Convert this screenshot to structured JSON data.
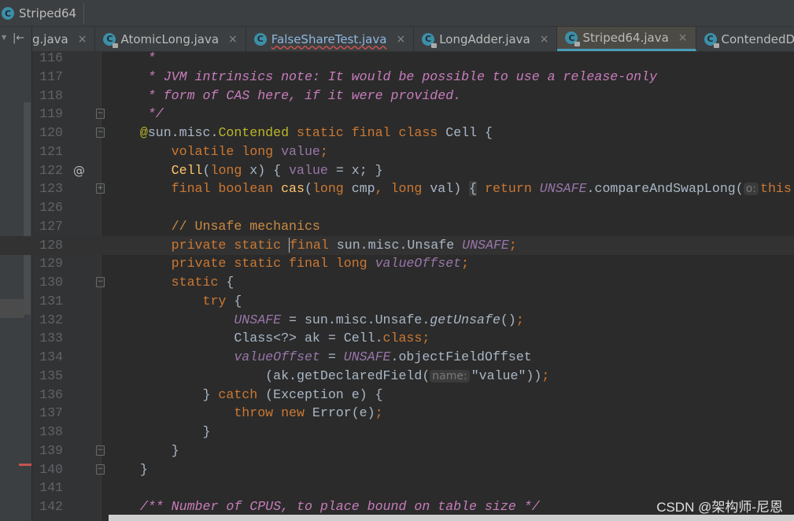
{
  "breadcrumb": {
    "label": "Striped64",
    "icon": "class-icon"
  },
  "tabs": [
    {
      "label": "g.java",
      "active": false
    },
    {
      "label": "AtomicLong.java",
      "active": false
    },
    {
      "label": "FalseShareTest.java",
      "active": false,
      "error": true
    },
    {
      "label": "LongAdder.java",
      "active": false
    },
    {
      "label": "Striped64.java",
      "active": true
    },
    {
      "label": "ContendedDemo.java",
      "active": false
    }
  ],
  "tab_close": "×",
  "colors": {
    "keyword": "#cc7832",
    "doc_comment": "#c77dbb",
    "field": "#9876aa",
    "annotation": "#bbb529",
    "method_decl": "#ffc66d",
    "text": "#a9b7c6",
    "active_tab_underline": "#4a9cb8"
  },
  "code": [
    {
      "n": "116",
      "fold": "",
      "toks": [
        [
          "     *",
          "doc"
        ]
      ]
    },
    {
      "n": "117",
      "fold": "",
      "toks": [
        [
          "     * JVM intrinsics note: It would be possible to use a release-only",
          "doc"
        ]
      ]
    },
    {
      "n": "118",
      "fold": "",
      "toks": [
        [
          "     * form of CAS here, if it were provided.",
          "doc"
        ]
      ]
    },
    {
      "n": "119",
      "fold": "-",
      "toks": [
        [
          "     */",
          "doc"
        ]
      ]
    },
    {
      "n": "120",
      "fold": "-",
      "toks": [
        [
          "    ",
          ""
        ],
        [
          "@",
          "ann"
        ],
        [
          "sun.misc.",
          ""
        ],
        [
          "Contended",
          "ann"
        ],
        [
          " static final class ",
          "kw"
        ],
        [
          "Cell {",
          ""
        ]
      ]
    },
    {
      "n": "121",
      "fold": "",
      "toks": [
        [
          "        ",
          ""
        ],
        [
          "volatile long ",
          "kw"
        ],
        [
          "value",
          "field"
        ],
        [
          ";",
          "kw"
        ]
      ]
    },
    {
      "n": "122",
      "fold": "",
      "at": "@",
      "toks": [
        [
          "        ",
          ""
        ],
        [
          "Cell",
          "decl"
        ],
        [
          "(",
          ""
        ],
        [
          "long ",
          "kw"
        ],
        [
          "x) { ",
          ""
        ],
        [
          "value",
          "field"
        ],
        [
          " = x; }",
          ""
        ]
      ]
    },
    {
      "n": "123",
      "fold": "+",
      "toks": [
        [
          "        ",
          ""
        ],
        [
          "final boolean ",
          "kw"
        ],
        [
          "cas",
          "decl"
        ],
        [
          "(",
          ""
        ],
        [
          "long ",
          "kw"
        ],
        [
          "cmp",
          ""
        ],
        [
          ", ",
          "kw"
        ],
        [
          "long ",
          "kw"
        ],
        [
          "val) ",
          ""
        ],
        [
          "{",
          "foldbox"
        ],
        [
          " ",
          ""
        ],
        [
          "return ",
          "kw"
        ],
        [
          "UNSAFE",
          "sfield"
        ],
        [
          ".compareAndSwapLong(",
          ""
        ],
        [
          "o:",
          "hint"
        ],
        [
          "this",
          "kw"
        ]
      ]
    },
    {
      "n": "126",
      "fold": "",
      "toks": []
    },
    {
      "n": "127",
      "fold": "",
      "toks": [
        [
          "        ",
          ""
        ],
        [
          "// Unsafe mechanics",
          "cmt"
        ]
      ]
    },
    {
      "n": "128",
      "fold": "",
      "cur": true,
      "toks": [
        [
          "        ",
          ""
        ],
        [
          "private static ",
          "kw"
        ],
        [
          "final ",
          "kw caret"
        ],
        [
          "sun.misc.Unsafe ",
          ""
        ],
        [
          "UNSAFE",
          "sfield"
        ],
        [
          ";",
          "kw"
        ]
      ]
    },
    {
      "n": "129",
      "fold": "",
      "toks": [
        [
          "        ",
          ""
        ],
        [
          "private static final long ",
          "kw"
        ],
        [
          "valueOffset",
          "sfield"
        ],
        [
          ";",
          "kw"
        ]
      ]
    },
    {
      "n": "130",
      "fold": "-",
      "toks": [
        [
          "        ",
          ""
        ],
        [
          "static",
          "kw"
        ],
        [
          " {",
          ""
        ]
      ]
    },
    {
      "n": "131",
      "fold": "",
      "toks": [
        [
          "            ",
          ""
        ],
        [
          "try",
          "kw"
        ],
        [
          " {",
          ""
        ]
      ]
    },
    {
      "n": "132",
      "fold": "",
      "toks": [
        [
          "                ",
          ""
        ],
        [
          "UNSAFE",
          "sfield"
        ],
        [
          " = sun.misc.Unsafe.",
          ""
        ],
        [
          "getUnsafe",
          "smethod"
        ],
        [
          "()",
          ""
        ],
        [
          ";",
          "kw"
        ]
      ]
    },
    {
      "n": "133",
      "fold": "",
      "toks": [
        [
          "                Class<?> ak = Cell.",
          ""
        ],
        [
          "class",
          "kw"
        ],
        [
          ";",
          "kw"
        ]
      ]
    },
    {
      "n": "134",
      "fold": "",
      "toks": [
        [
          "                ",
          ""
        ],
        [
          "valueOffset",
          "sfield"
        ],
        [
          " = ",
          ""
        ],
        [
          "UNSAFE",
          "sfield"
        ],
        [
          ".objectFieldOffset",
          ""
        ]
      ]
    },
    {
      "n": "135",
      "fold": "",
      "toks": [
        [
          "                    (ak.getDeclaredField(",
          ""
        ],
        [
          "name:",
          "hint"
        ],
        [
          "\"value\"",
          "str"
        ],
        [
          "))",
          ""
        ],
        [
          ";",
          "kw"
        ]
      ]
    },
    {
      "n": "136",
      "fold": "",
      "toks": [
        [
          "            } ",
          ""
        ],
        [
          "catch",
          "kw"
        ],
        [
          " (Exception e) {",
          ""
        ]
      ]
    },
    {
      "n": "137",
      "fold": "",
      "toks": [
        [
          "                ",
          ""
        ],
        [
          "throw new ",
          "kw"
        ],
        [
          "Error(e)",
          ""
        ],
        [
          ";",
          "kw"
        ]
      ]
    },
    {
      "n": "138",
      "fold": "",
      "toks": [
        [
          "            }",
          ""
        ]
      ]
    },
    {
      "n": "139",
      "fold": "-",
      "toks": [
        [
          "        }",
          ""
        ]
      ]
    },
    {
      "n": "140",
      "fold": "-",
      "toks": [
        [
          "    }",
          ""
        ]
      ]
    },
    {
      "n": "141",
      "fold": "",
      "toks": []
    },
    {
      "n": "142",
      "fold": "",
      "toks": [
        [
          "    /** Number of CPUS, to place bound on table size */",
          "doc"
        ]
      ]
    }
  ],
  "watermark": "CSDN @架构师-尼恩"
}
